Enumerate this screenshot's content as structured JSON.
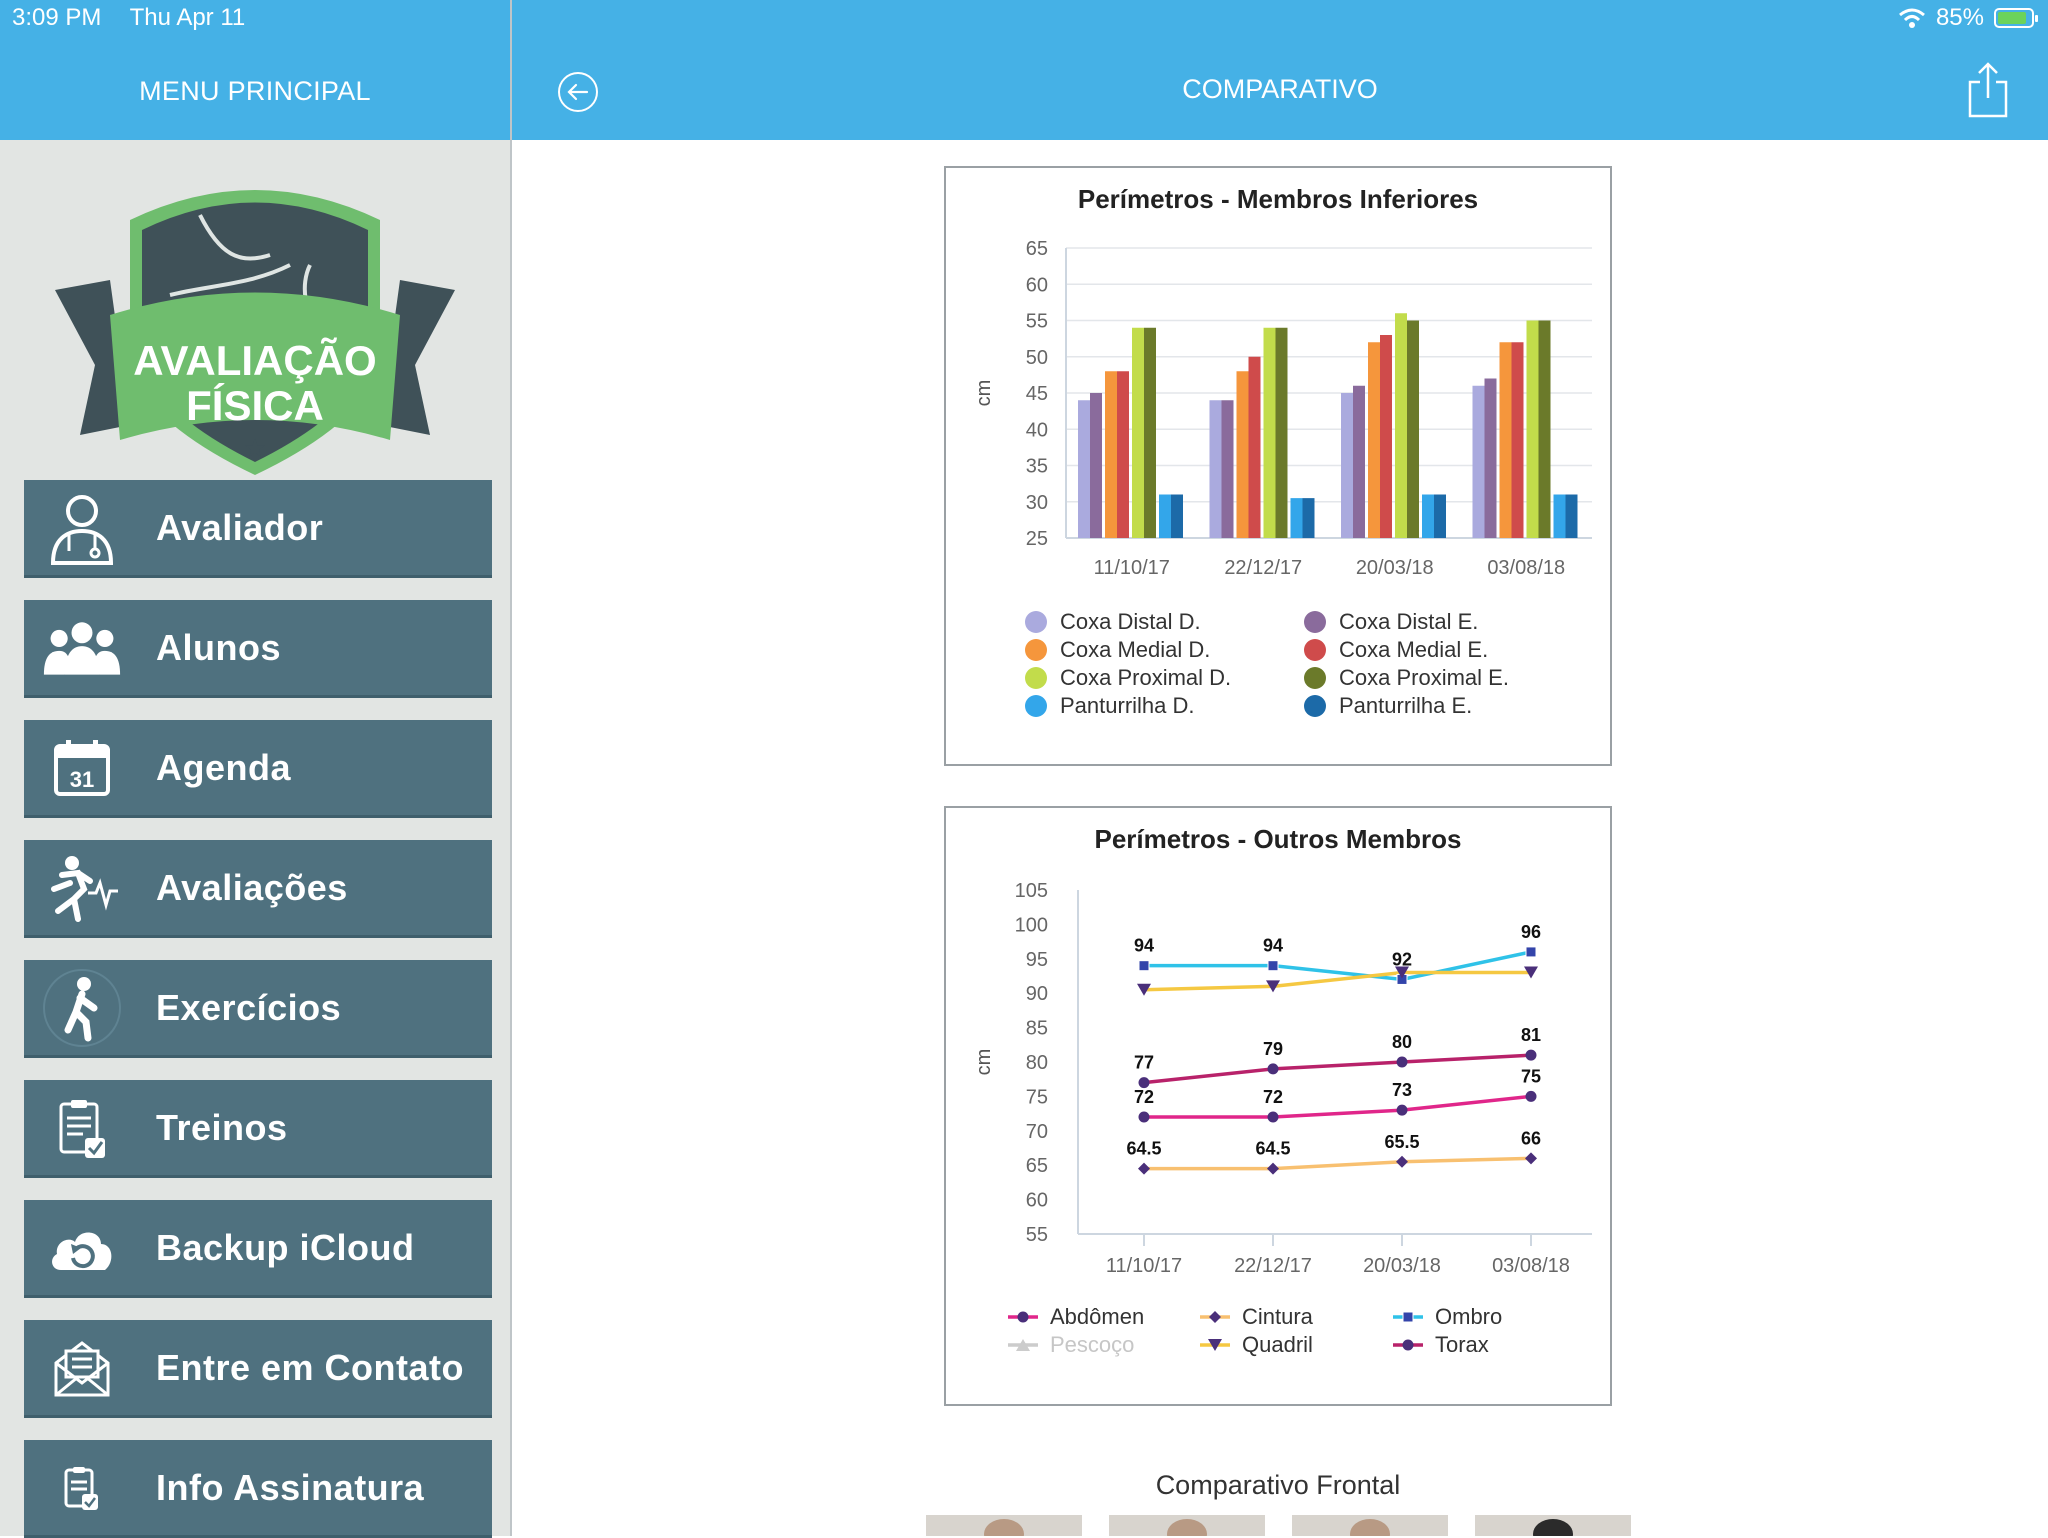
{
  "status_bar": {
    "time": "3:09 PM",
    "date": "Thu Apr 11",
    "battery": "85%"
  },
  "sidebar": {
    "title": "MENU PRINCIPAL",
    "logo_text": [
      "AVALIAÇÃO",
      "FÍSICA"
    ],
    "items": [
      {
        "label": "Avaliador",
        "icon": "doctor-icon"
      },
      {
        "label": "Alunos",
        "icon": "users-icon"
      },
      {
        "label": "Agenda",
        "icon": "calendar-icon"
      },
      {
        "label": "Avaliações",
        "icon": "runner-heartbeat-icon"
      },
      {
        "label": "Exercícios",
        "icon": "exercise-icon"
      },
      {
        "label": "Treinos",
        "icon": "clipboard-check-icon"
      },
      {
        "label": "Backup iCloud",
        "icon": "cloud-sync-icon"
      },
      {
        "label": "Entre em Contato",
        "icon": "mail-icon"
      },
      {
        "label": "Info Assinatura",
        "icon": "subscription-icon"
      }
    ]
  },
  "header": {
    "title": "COMPARATIVO"
  },
  "charts": {
    "bar": {
      "type": "bar",
      "title": "Perímetros - Membros Inferiores",
      "ylabel": "cm",
      "ylim": [
        25,
        65
      ],
      "yticks": [
        65,
        60,
        55,
        50,
        45,
        40,
        35,
        30,
        25
      ],
      "categories": [
        "11/10/17",
        "22/12/17",
        "20/03/18",
        "03/08/18"
      ],
      "series": [
        {
          "name": "Coxa Distal D.",
          "color": "#aaaade",
          "values": [
            44,
            44,
            45,
            46
          ]
        },
        {
          "name": "Coxa Distal E.",
          "color": "#8a6b9c",
          "values": [
            45,
            44,
            46,
            47
          ]
        },
        {
          "name": "Coxa Medial D.",
          "color": "#f5963c",
          "values": [
            48,
            48,
            52,
            52
          ]
        },
        {
          "name": "Coxa Medial E.",
          "color": "#cf4b4b",
          "values": [
            48,
            50,
            53,
            52
          ]
        },
        {
          "name": "Coxa Proximal D.",
          "color": "#c2dc4b",
          "values": [
            54,
            54,
            56,
            55
          ]
        },
        {
          "name": "Coxa Proximal E.",
          "color": "#6b7a2a",
          "values": [
            54,
            54,
            55,
            55
          ]
        },
        {
          "name": "Panturrilha D.",
          "color": "#33a6ea",
          "values": [
            31,
            30.5,
            31,
            31
          ]
        },
        {
          "name": "Panturrilha E.",
          "color": "#1c6aa8",
          "values": [
            31,
            30.5,
            31,
            31
          ]
        }
      ],
      "legend_left": [
        "Coxa Distal D.",
        "Coxa Medial D.",
        "Coxa Proximal D.",
        "Panturrilha D."
      ],
      "legend_right": [
        "Coxa Distal E.",
        "Coxa Medial E.",
        "Coxa Proximal E.",
        "Panturrilha E."
      ]
    },
    "line": {
      "type": "line",
      "title": "Perímetros - Outros Membros",
      "ylabel": "cm",
      "ylim": [
        55,
        105
      ],
      "yticks": [
        105,
        100,
        95,
        90,
        85,
        80,
        75,
        70,
        65,
        60,
        55
      ],
      "categories": [
        "11/10/17",
        "22/12/17",
        "20/03/18",
        "03/08/18"
      ],
      "series": [
        {
          "name": "Ombro",
          "color": "#2fc2e8",
          "marker": "square",
          "values": [
            94,
            94,
            92,
            96
          ],
          "labels": [
            "94",
            "94",
            "92",
            "96"
          ]
        },
        {
          "name": "Quadril",
          "color": "#f5c842",
          "marker": "triangle",
          "values": [
            90.5,
            91,
            93,
            93
          ]
        },
        {
          "name": "Torax",
          "color": "#b8226a",
          "marker": "circle",
          "values": [
            77,
            79,
            80,
            81
          ],
          "labels": [
            "77",
            "79",
            "80",
            "81"
          ]
        },
        {
          "name": "Abdômen",
          "color": "#e0268a",
          "marker": "circle",
          "values": [
            72,
            72,
            73,
            75
          ],
          "labels": [
            "72",
            "72",
            "73",
            "75"
          ]
        },
        {
          "name": "Cintura",
          "color": "#f8c070",
          "marker": "diamond",
          "values": [
            64.5,
            64.5,
            65.5,
            66
          ],
          "labels": [
            "64.5",
            "64.5",
            "65.5",
            "66"
          ]
        }
      ],
      "legend": [
        {
          "name": "Abdômen",
          "color": "#e0268a",
          "marker": "circle"
        },
        {
          "name": "Cintura",
          "color": "#f8c070",
          "marker": "diamond"
        },
        {
          "name": "Ombro",
          "color": "#2fc2e8",
          "marker": "square"
        },
        {
          "name": "Pescoço",
          "color": "#cccccc",
          "marker": "triangle-up"
        },
        {
          "name": "Quadril",
          "color": "#f5c842",
          "marker": "triangle"
        },
        {
          "name": "Torax",
          "color": "#b8226a",
          "marker": "circle"
        }
      ]
    }
  },
  "frontal": {
    "title": "Comparativo Frontal"
  }
}
